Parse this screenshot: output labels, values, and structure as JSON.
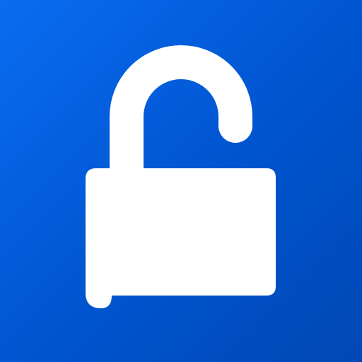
{
  "app_icon": {
    "icon": "unlocked-padlock-icon",
    "colors": {
      "background_start": "#0a6cf0",
      "background_end": "#0048b4",
      "glyph": "#ffffff"
    }
  }
}
